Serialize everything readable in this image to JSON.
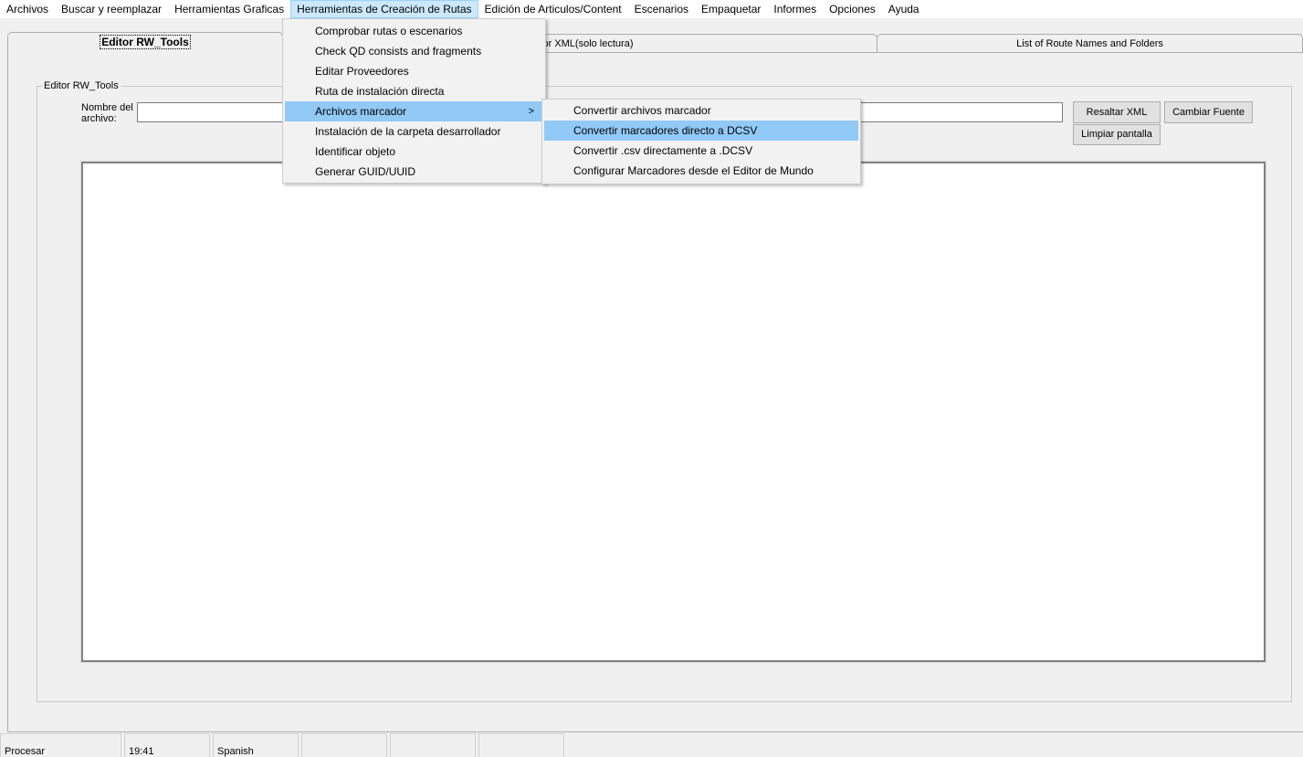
{
  "menubar": {
    "items": [
      "Archivos",
      "Buscar y reemplazar",
      "Herramientas Graficas",
      "Herramientas de Creación de Rutas",
      "Edición de Articulos/Content",
      "Escenarios",
      "Empaquetar",
      "Informes",
      "Opciones",
      "Ayuda"
    ]
  },
  "dropdown": {
    "items": [
      "Comprobar rutas o escenarios",
      "Check QD consists and fragments",
      "Editar Proveedores",
      "Ruta de instalación directa",
      "Archivos marcador",
      "Instalación de la carpeta desarrollador",
      "Identificar objeto",
      "Generar GUID/UUID"
    ],
    "arrow": ">"
  },
  "submenu": {
    "items": [
      "Convertir archivos marcador",
      "Convertir marcadores directo a DCSV",
      "Convertir .csv directamente a .DCSV",
      "Configurar Marcadores desde el Editor de Mundo"
    ]
  },
  "tabs": {
    "editor": "Editor RW_Tools",
    "xml": "Editor XML(solo lectura)",
    "routes": "List of Route Names and Folders"
  },
  "panel": {
    "group_label": "Editor RW_Tools",
    "filename_label_1": "Nombre del",
    "filename_label_2": "archivo:",
    "filename_value": "",
    "resaltar_xml": "Resaltar XML",
    "cambiar_fuente": "Cambiar Fuente",
    "limpiar_pantalla": "Limpiar pantalla"
  },
  "statusbar": {
    "panels": [
      "Procesar",
      "19:41",
      "Spanish",
      "",
      "",
      ""
    ]
  }
}
